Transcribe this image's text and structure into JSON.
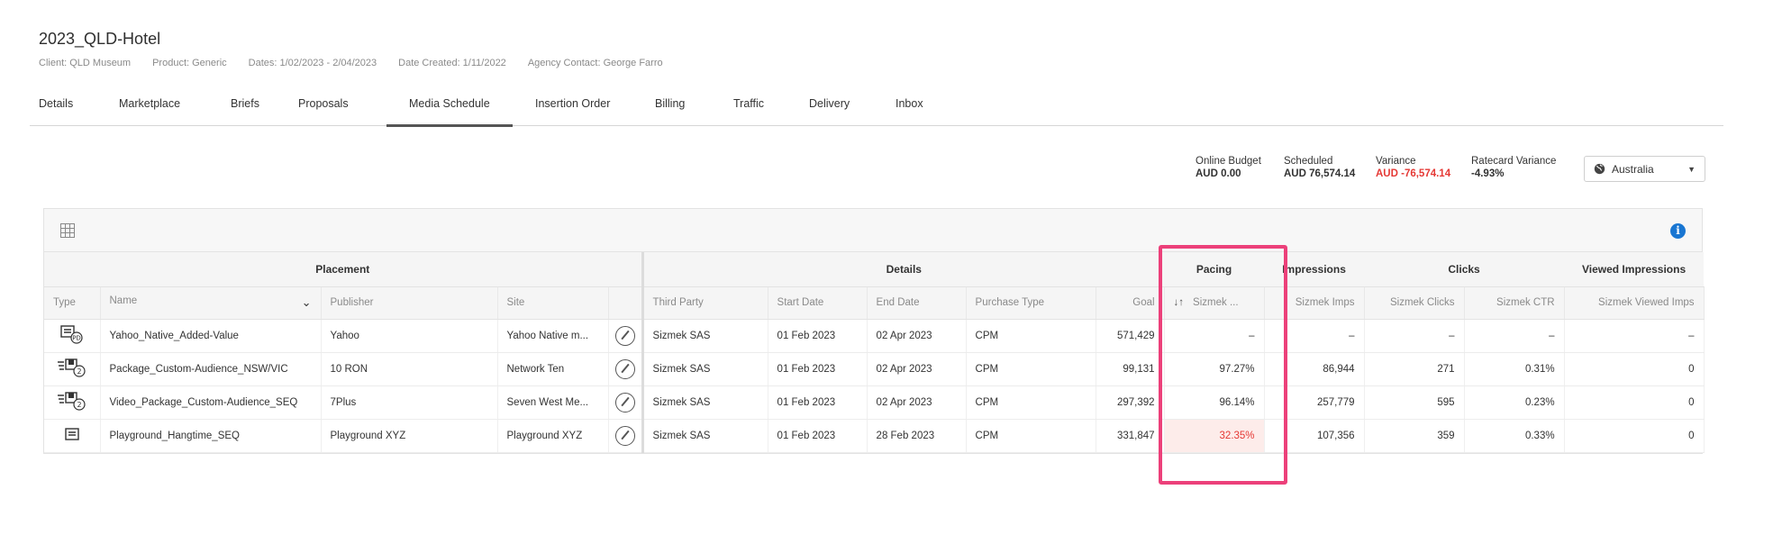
{
  "header": {
    "title": "2023_QLD-Hotel",
    "client": "Client: QLD Museum",
    "product": "Product: Generic",
    "dates": "Dates: 1/02/2023 - 2/04/2023",
    "date_created": "Date Created: 1/11/2022",
    "agency_contact": "Agency Contact: George Farro"
  },
  "tabs": [
    "Details",
    "Marketplace",
    "Briefs",
    "Proposals",
    "Media Schedule",
    "Insertion Order",
    "Billing",
    "Traffic",
    "Delivery",
    "Inbox"
  ],
  "active_tab": "Media Schedule",
  "summary": {
    "online_budget_label": "Online Budget",
    "online_budget_value": "AUD 0.00",
    "scheduled_label": "Scheduled",
    "scheduled_value": "AUD 76,574.14",
    "variance_label": "Variance",
    "variance_value": "AUD -76,574.14",
    "ratecard_label": "Ratecard Variance",
    "ratecard_value": "-4.93%"
  },
  "region": {
    "value": "Australia",
    "icon": "globe-icon"
  },
  "table": {
    "groups": {
      "placement": "Placement",
      "details": "Details",
      "pacing": "Pacing",
      "impressions": "Impressions",
      "clicks": "Clicks",
      "viewed": "Viewed Impressions"
    },
    "columns": {
      "type": "Type",
      "name": "Name",
      "publisher": "Publisher",
      "site": "Site",
      "third_party": "Third Party",
      "start_date": "Start Date",
      "end_date": "End Date",
      "purchase_type": "Purchase Type",
      "goal": "Goal",
      "pacing": "Sizmek ...",
      "imps": "Sizmek Imps",
      "clicks": "Sizmek Clicks",
      "ctr": "Sizmek CTR",
      "viewed": "Sizmek Viewed Imps"
    },
    "rows": [
      {
        "type_icon": "native-pd-icon",
        "name": "Yahoo_Native_Added-Value",
        "publisher": "Yahoo",
        "site": "Yahoo Native m...",
        "third_party": "Sizmek SAS",
        "start": "01 Feb 2023",
        "end": "02 Apr 2023",
        "purchase": "CPM",
        "goal": "571,429",
        "pacing": "–",
        "imps": "–",
        "clicks": "–",
        "ctr": "–",
        "viewed": "–"
      },
      {
        "type_icon": "package-2-icon",
        "name": "Package_Custom-Audience_NSW/VIC",
        "publisher": "10 RON",
        "site": "Network Ten",
        "third_party": "Sizmek SAS",
        "start": "01 Feb 2023",
        "end": "02 Apr 2023",
        "purchase": "CPM",
        "goal": "99,131",
        "pacing": "97.27%",
        "imps": "86,944",
        "clicks": "271",
        "ctr": "0.31%",
        "viewed": "0"
      },
      {
        "type_icon": "package-2-icon",
        "name": "Video_Package_Custom-Audience_SEQ",
        "publisher": "7Plus",
        "site": "Seven West Me...",
        "third_party": "Sizmek SAS",
        "start": "01 Feb 2023",
        "end": "02 Apr 2023",
        "purchase": "CPM",
        "goal": "297,392",
        "pacing": "96.14%",
        "imps": "257,779",
        "clicks": "595",
        "ctr": "0.23%",
        "viewed": "0"
      },
      {
        "type_icon": "display-icon",
        "name": "Playground_Hangtime_SEQ",
        "publisher": "Playground XYZ",
        "site": "Playground XYZ",
        "third_party": "Sizmek SAS",
        "start": "01 Feb 2023",
        "end": "28 Feb 2023",
        "purchase": "CPM",
        "goal": "331,847",
        "pacing": "32.35%",
        "imps": "107,356",
        "clicks": "359",
        "ctr": "0.33%",
        "viewed": "0"
      }
    ]
  },
  "colors": {
    "accent": "#1976d2",
    "negative": "#e53935",
    "highlight": "#ec407a",
    "low_pacing_bg": "#fdecea"
  }
}
